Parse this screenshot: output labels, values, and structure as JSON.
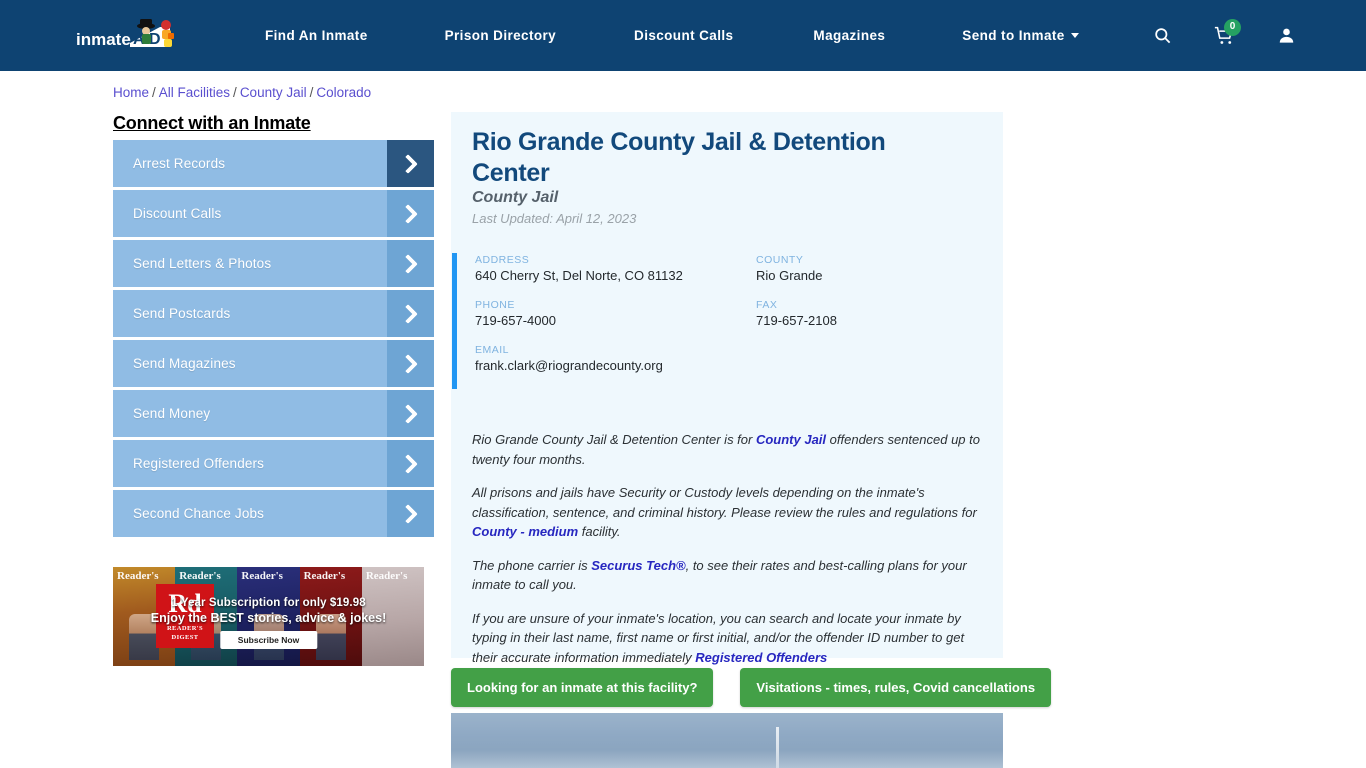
{
  "nav": {
    "logo_text": "inmateAID",
    "links": [
      {
        "label": "Find An Inmate"
      },
      {
        "label": "Prison Directory"
      },
      {
        "label": "Discount Calls"
      },
      {
        "label": "Magazines"
      },
      {
        "label": "Send to Inmate"
      }
    ],
    "icons": {
      "search": "search-icon",
      "cart": "shopping-cart-icon",
      "cart_count": "0",
      "account": "user-account-icon"
    },
    "colors": {
      "bar": "#0e4372",
      "badge": "#25a162"
    }
  },
  "breadcrumb": {
    "items": [
      "Home",
      "All Facilities",
      "County Jail",
      "Colorado"
    ],
    "separator": "/"
  },
  "sidebar": {
    "title": "Connect with an Inmate",
    "items": [
      {
        "label": "Arrest Records",
        "active": true
      },
      {
        "label": "Discount Calls",
        "active": false
      },
      {
        "label": "Send Letters & Photos",
        "active": false
      },
      {
        "label": "Send Postcards",
        "active": false
      },
      {
        "label": "Send Magazines",
        "active": false
      },
      {
        "label": "Send Money",
        "active": false
      },
      {
        "label": "Registered Offenders",
        "active": false
      },
      {
        "label": "Second Chance Jobs",
        "active": false
      }
    ]
  },
  "ad": {
    "brand": "Reader's",
    "brand_sub": "digest",
    "logo_mark": "Rd",
    "logo_sub_1": "READER'S",
    "logo_sub_2": "DIGEST",
    "line1": "1 Year Subscription for only $19.98",
    "line2": "Enjoy the BEST stories, advice & jokes!",
    "cta": "Subscribe Now"
  },
  "facility": {
    "title": "Rio Grande County Jail & Detention Center",
    "type": "County Jail",
    "last_updated": "Last Updated: April 12, 2023",
    "fields": {
      "address_label": "ADDRESS",
      "address_value": "640 Cherry St, Del Norte, CO 81132",
      "phone_label": "PHONE",
      "phone_value": "719-657-4000",
      "email_label": "EMAIL",
      "email_value": "frank.clark@riograndecounty.org",
      "county_label": "COUNTY",
      "county_value": "Rio Grande",
      "fax_label": "FAX",
      "fax_value": "719-657-2108"
    },
    "paragraphs": {
      "p1_a": "Rio Grande County Jail & Detention Center is for ",
      "p1_link": "County Jail",
      "p1_b": " offenders sentenced up to twenty four months.",
      "p2_a": "All prisons and jails have Security or Custody levels depending on the inmate's classification, sentence, and criminal history. Please review the rules and regulations for ",
      "p2_link": "County - medium",
      "p2_b": " facility.",
      "p3_a": "The phone carrier is ",
      "p3_link": "Securus Tech®",
      "p3_b": ", to see their rates and best-calling plans for your inmate to call you.",
      "p4_a": "If you are unsure of your inmate's location, you can search and locate your inmate by typing in their last name, first name or first initial, and/or the offender ID number to get their accurate information immediately ",
      "p4_link": "Registered Offenders"
    }
  },
  "actions": {
    "search_inmate": "Looking for an inmate at this facility?",
    "visitations": "Visitations - times, rules, Covid cancellations"
  },
  "theme": {
    "nav_blue": "#0e4372",
    "card_blue": "#eff8fd",
    "accent_bar": "#2196f3",
    "title_blue": "#12497c",
    "link_blue": "#2727c0",
    "green": "#43a047",
    "sidebar_blue": "#90bce4",
    "sidebar_arrow": "#6ea5d4",
    "sidebar_arrow_active": "#2b5680"
  }
}
